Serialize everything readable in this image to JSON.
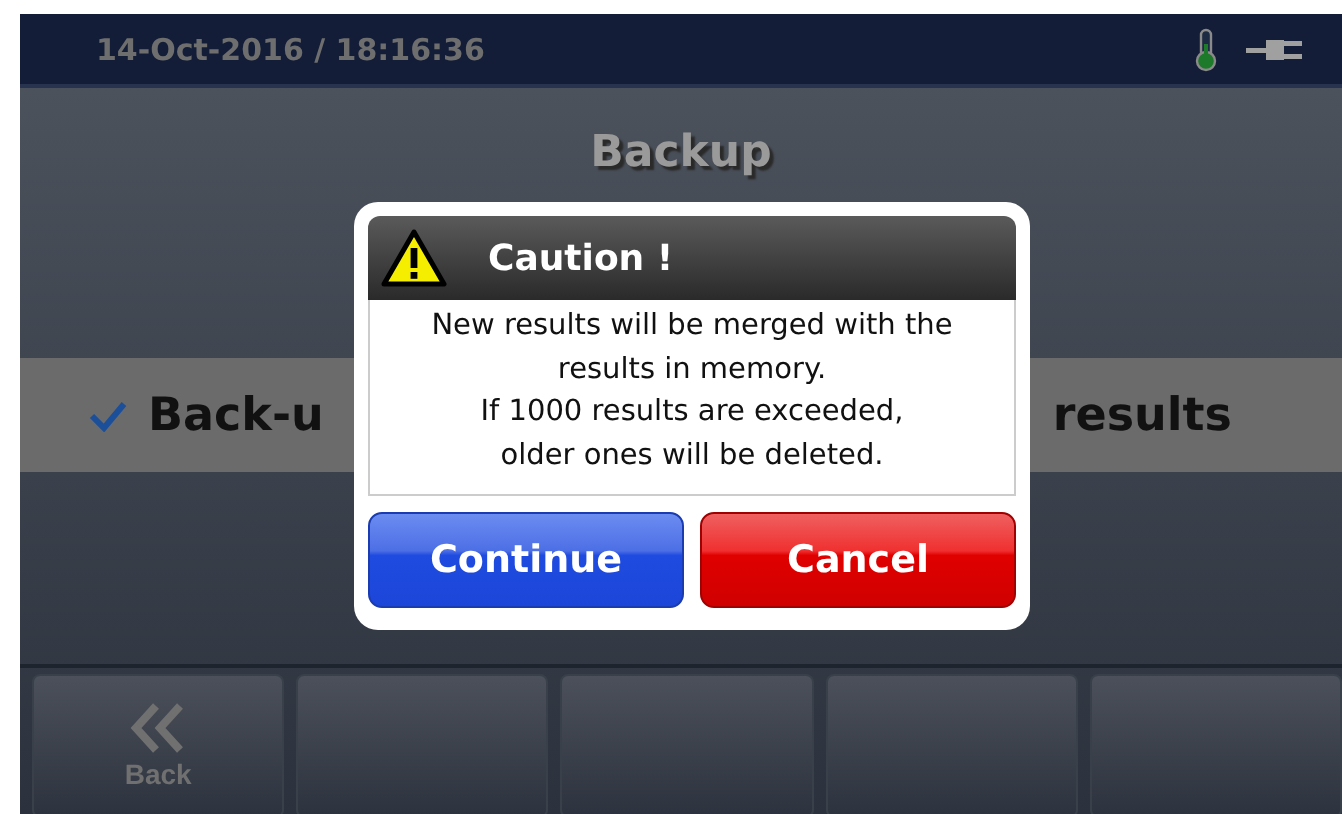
{
  "status_bar": {
    "datetime": "14-Oct-2016 / 18:16:36"
  },
  "screen": {
    "title": "Backup"
  },
  "option": {
    "checked": true,
    "label_start": "Back-u",
    "label_end": "results"
  },
  "dialog": {
    "title": "Caution !",
    "message": "New results will be merged with the\nresults in memory.\nIf 1000 results are exceeded,\nolder ones will be deleted.",
    "buttons": [
      {
        "label": "Continue",
        "kind": "confirm"
      },
      {
        "label": "Cancel",
        "kind": "cancel"
      }
    ]
  },
  "softkeys": [
    {
      "kind": "back",
      "label": "Back"
    },
    {
      "kind": "empty"
    },
    {
      "kind": "empty"
    },
    {
      "kind": "empty"
    },
    {
      "kind": "empty"
    }
  ]
}
